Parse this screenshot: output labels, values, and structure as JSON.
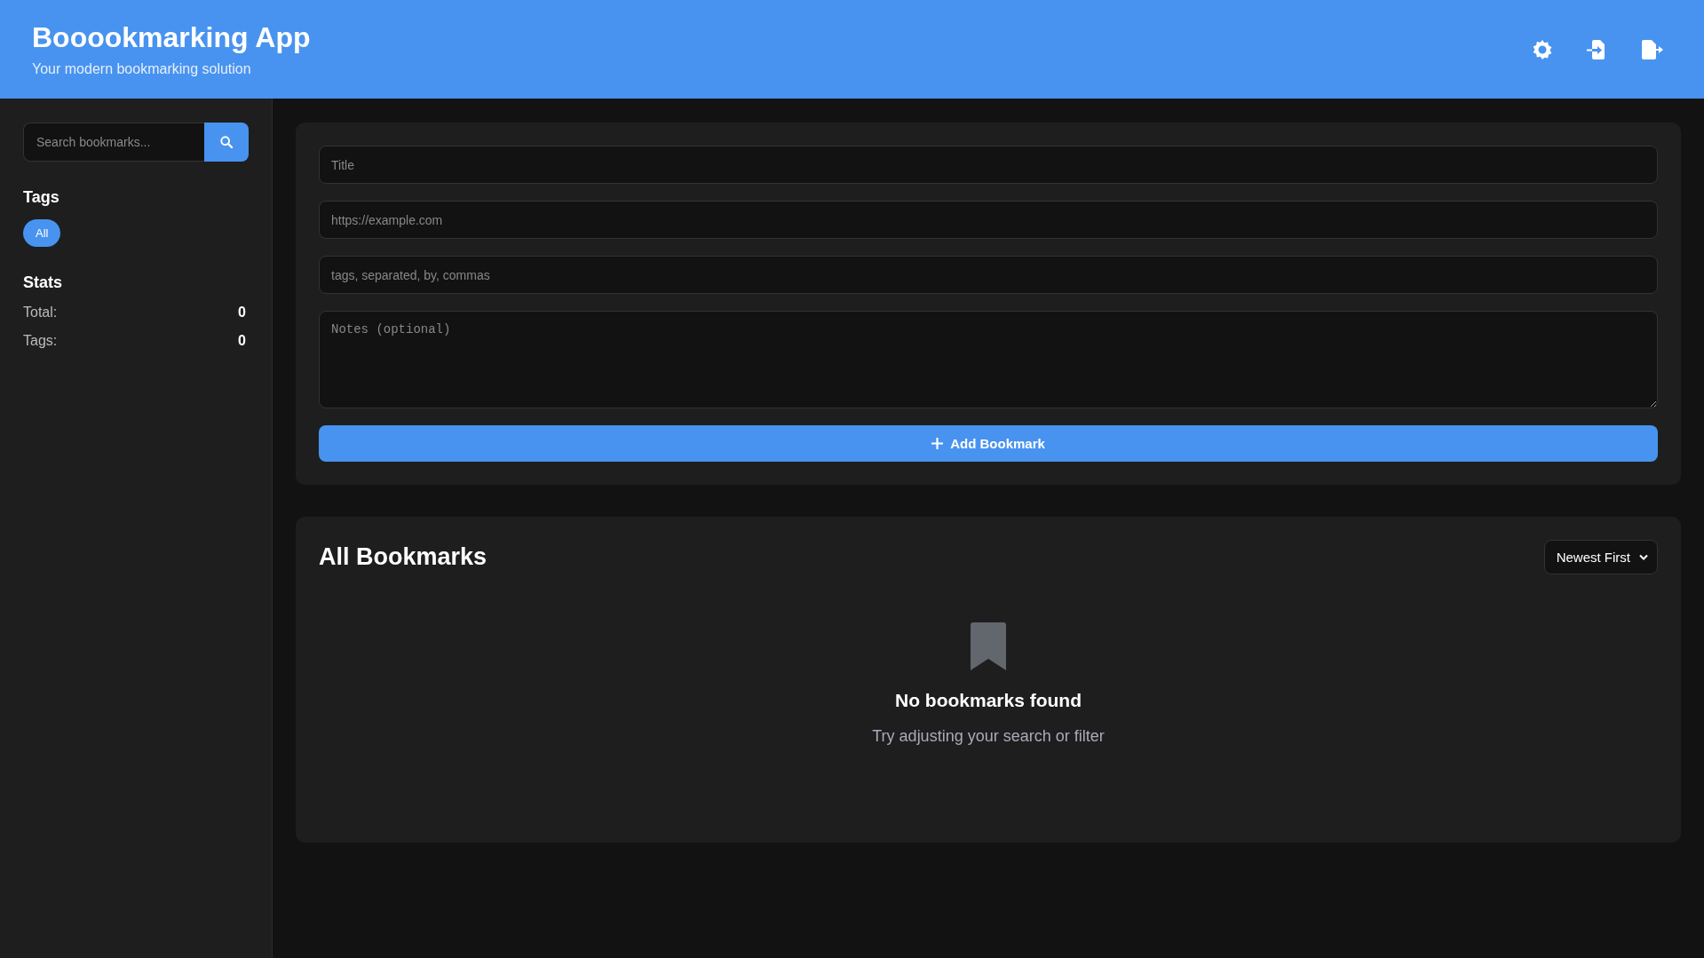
{
  "header": {
    "title": "Booookmarking App",
    "subtitle": "Your modern bookmarking solution"
  },
  "sidebar": {
    "search": {
      "placeholder": "Search bookmarks..."
    },
    "tags_heading": "Tags",
    "tags": [
      {
        "label": "All",
        "selected": true
      }
    ],
    "stats_heading": "Stats",
    "stats": [
      {
        "label": "Total:",
        "value": "0"
      },
      {
        "label": "Tags:",
        "value": "0"
      }
    ]
  },
  "form": {
    "fields": [
      {
        "kind": "input",
        "placeholder": "Title"
      },
      {
        "kind": "input",
        "placeholder": "https://example.com"
      },
      {
        "kind": "input",
        "placeholder": "tags, separated, by, commas"
      },
      {
        "kind": "textarea",
        "placeholder": "Notes (optional)"
      }
    ],
    "submit": "Add Bookmark"
  },
  "list": {
    "heading": "All Bookmarks",
    "sort": "Newest First",
    "empty_title": "No bookmarks found",
    "empty_text": "Try adjusting your search or filter"
  }
}
